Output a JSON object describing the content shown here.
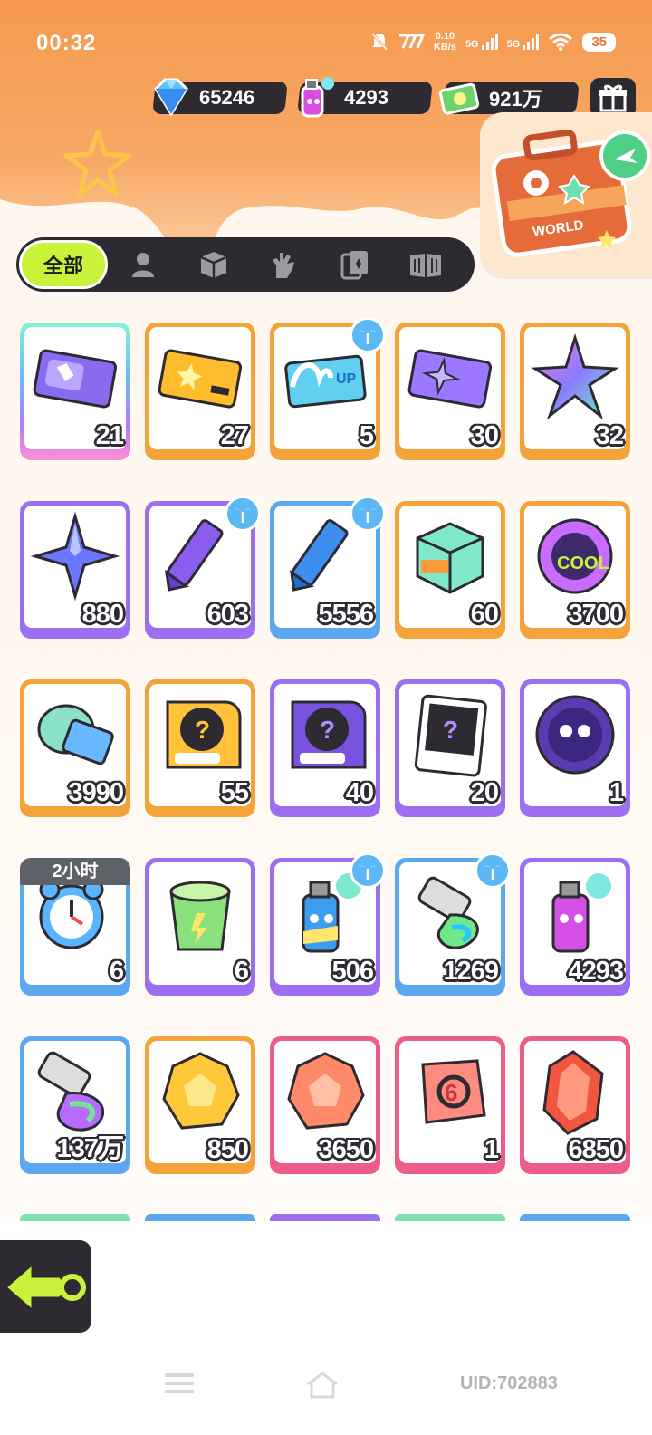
{
  "status_bar": {
    "time": "00:32",
    "net_speed_value": "0.10",
    "net_speed_unit": "KB/s",
    "signal1": "5G",
    "signal2": "5G",
    "battery": "35"
  },
  "currencies": [
    {
      "name": "diamond",
      "value": "65246",
      "icon": "diamond-icon"
    },
    {
      "name": "spray-can",
      "value": "4293",
      "icon": "spray-can-icon"
    },
    {
      "name": "cash",
      "value": "921万",
      "icon": "cash-icon"
    }
  ],
  "world_card": {
    "label": "WORLD"
  },
  "filter_tabs": {
    "all_label": "全部",
    "icons": [
      "person-icon",
      "box-icon",
      "hand-icon",
      "cards-icon",
      "book-icon"
    ]
  },
  "items": [
    {
      "name": "purple-ticket",
      "qty": "21",
      "border": "rainbow"
    },
    {
      "name": "gold-ticket",
      "qty": "27",
      "border": "orange"
    },
    {
      "name": "wave-up-ticket",
      "qty": "5",
      "border": "orange",
      "palm": true
    },
    {
      "name": "star-ticket",
      "qty": "30",
      "border": "orange"
    },
    {
      "name": "rainbow-star",
      "qty": "32",
      "border": "orange"
    },
    {
      "name": "blue-star",
      "qty": "880",
      "border": "purple"
    },
    {
      "name": "purple-crayon",
      "qty": "603",
      "border": "purple",
      "palm": true
    },
    {
      "name": "blue-crayon",
      "qty": "5556",
      "border": "blue",
      "palm": true
    },
    {
      "name": "color-box",
      "qty": "60",
      "border": "orange"
    },
    {
      "name": "cool-sticker",
      "qty": "3700",
      "border": "orange"
    },
    {
      "name": "season-ticket",
      "qty": "3990",
      "border": "orange"
    },
    {
      "name": "gold-deity-mystery",
      "qty": "55",
      "border": "orange"
    },
    {
      "name": "purple-deity-mystery",
      "qty": "40",
      "border": "purple"
    },
    {
      "name": "travel-card-mystery",
      "qty": "20",
      "border": "purple"
    },
    {
      "name": "mpets-coin",
      "qty": "1",
      "border": "purple"
    },
    {
      "name": "alarm-clock",
      "qty": "6",
      "border": "blue",
      "timer": "2小时"
    },
    {
      "name": "green-cup",
      "qty": "6",
      "border": "purple"
    },
    {
      "name": "blue-spray-can",
      "qty": "506",
      "border": "purple",
      "palm": true
    },
    {
      "name": "paint-tube-green",
      "qty": "1269",
      "border": "blue",
      "palm": true
    },
    {
      "name": "pink-spray-can",
      "qty": "4293",
      "border": "purple"
    },
    {
      "name": "paint-tube-rainbow",
      "qty": "137万",
      "border": "blue"
    },
    {
      "name": "yellow-gem",
      "qty": "850",
      "border": "orange"
    },
    {
      "name": "orange-gem",
      "qty": "3650",
      "border": "pink"
    },
    {
      "name": "dice-block",
      "qty": "1",
      "border": "pink"
    },
    {
      "name": "red-crystal",
      "qty": "6850",
      "border": "pink"
    }
  ],
  "back_label": "BACK",
  "uid": "UID:702883"
}
